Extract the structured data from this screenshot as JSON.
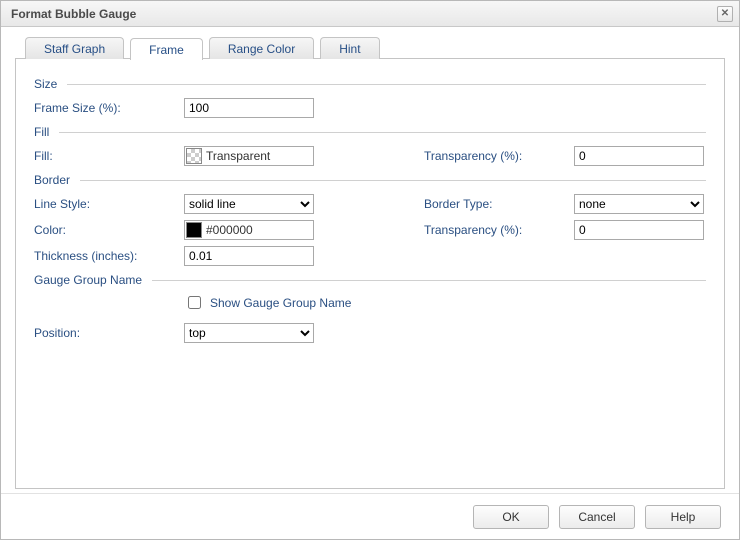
{
  "title": "Format Bubble Gauge",
  "tabs": [
    {
      "label": "Staff Graph",
      "active": false
    },
    {
      "label": "Frame",
      "active": true
    },
    {
      "label": "Range Color",
      "active": false
    },
    {
      "label": "Hint",
      "active": false
    }
  ],
  "sections": {
    "size": {
      "header": "Size",
      "frame_size_label": "Frame Size (%):",
      "frame_size_value": "100"
    },
    "fill": {
      "header": "Fill",
      "fill_label": "Fill:",
      "fill_value": "Transparent",
      "transparency_label": "Transparency (%):",
      "transparency_value": "0"
    },
    "border": {
      "header": "Border",
      "line_style_label": "Line Style:",
      "line_style_value": "solid line",
      "border_type_label": "Border Type:",
      "border_type_value": "none",
      "color_label": "Color:",
      "color_value": "#000000",
      "transparency_label": "Transparency (%):",
      "transparency_value": "0",
      "thickness_label": "Thickness (inches):",
      "thickness_value": "0.01"
    },
    "gauge_group": {
      "header": "Gauge Group Name",
      "show_label": "Show Gauge Group Name",
      "show_checked": false,
      "position_label": "Position:",
      "position_value": "top"
    }
  },
  "buttons": {
    "ok": "OK",
    "cancel": "Cancel",
    "help": "Help"
  }
}
